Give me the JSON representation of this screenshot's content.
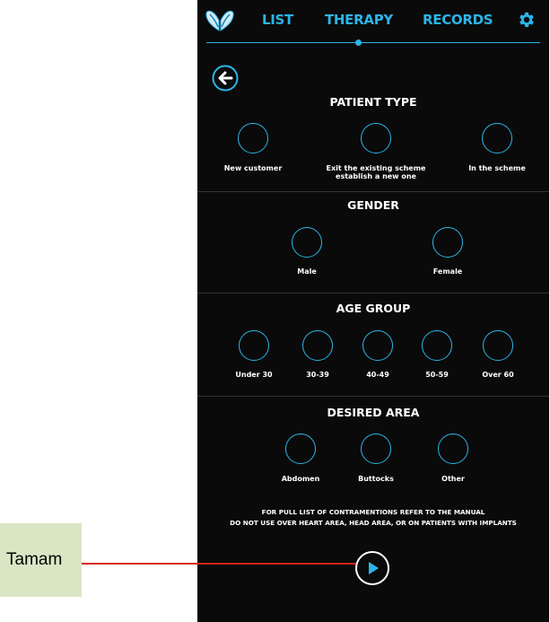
{
  "nav": {
    "tabs": [
      {
        "label": "LIST"
      },
      {
        "label": "THERAPY"
      },
      {
        "label": "RECORDS"
      }
    ],
    "active_tab": "THERAPY",
    "logo_icon": "wings-logo-icon",
    "settings_icon": "gear-icon"
  },
  "back_icon": "arrow-left-icon",
  "sections": {
    "patient_type": {
      "title": "PATIENT TYPE",
      "options": [
        "New customer",
        "Exit the existing scheme establish a new one",
        "In the scheme"
      ],
      "option_lines": [
        [
          "New customer"
        ],
        [
          "Exit the existing scheme",
          "establish a new one"
        ],
        [
          "In the scheme"
        ]
      ]
    },
    "gender": {
      "title": "GENDER",
      "options": [
        "Male",
        "Female"
      ]
    },
    "age_group": {
      "title": "AGE GROUP",
      "options": [
        "Under 30",
        "30-39",
        "40-49",
        "50-59",
        "Over 60"
      ]
    },
    "desired_area": {
      "title": "DESIRED AREA",
      "options": [
        "Abdomen",
        "Buttocks",
        "Other"
      ]
    }
  },
  "warning": {
    "line1": "FOR PULL LIST OF CONTRAMENTIONS REFER TO THE MANUAL",
    "line2": "DO NOT USE OVER HEART AREA, HEAD AREA, OR ON PATIENTS WITH IMPLANTS"
  },
  "play_icon": "play-icon",
  "annotation": {
    "label": "Tamam"
  },
  "colors": {
    "accent": "#2cb5e8",
    "background": "#0a0a0a",
    "annotation_box": "#d9e6c4",
    "annotation_line": "#d9261c"
  }
}
